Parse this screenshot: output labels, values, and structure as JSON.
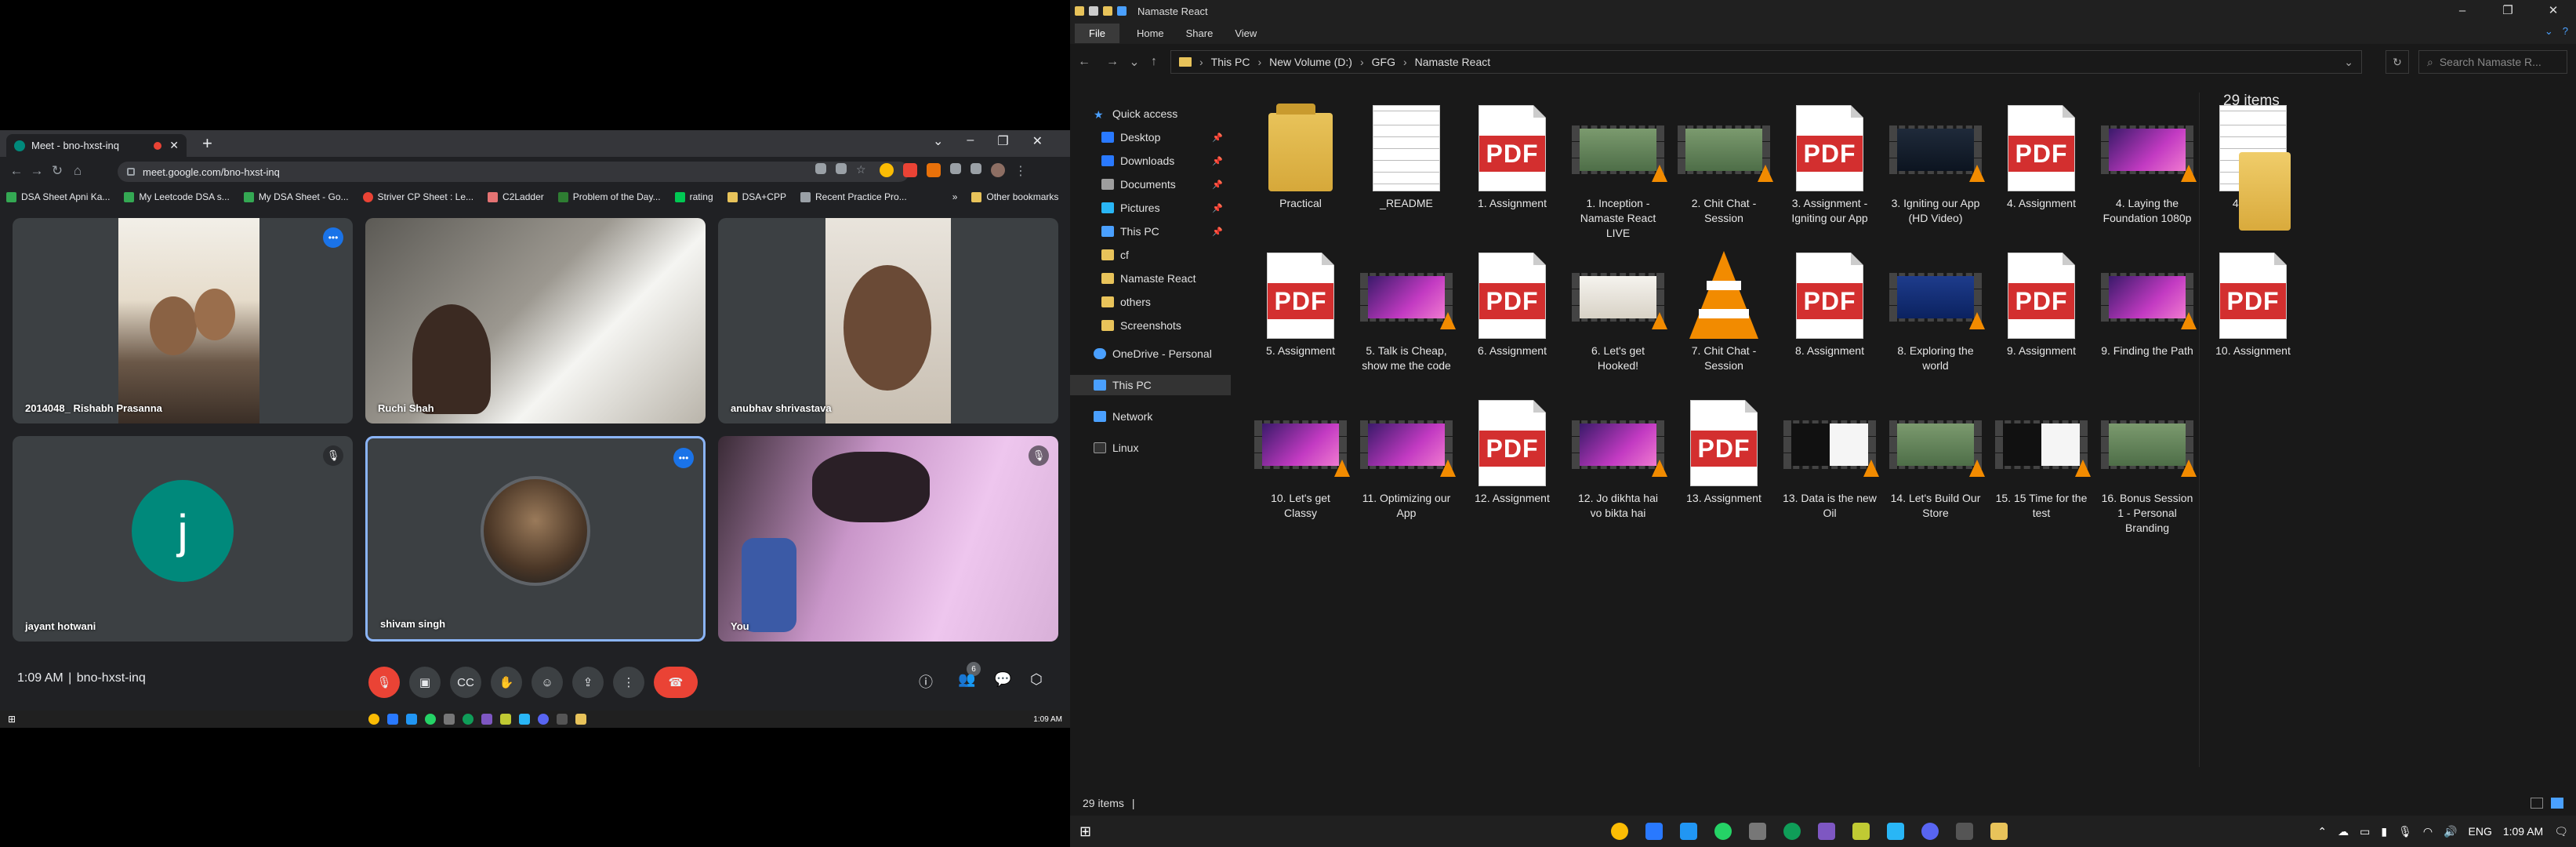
{
  "chrome": {
    "tab_title": "Meet - bno-hxst-inq",
    "url": "meet.google.com/bno-hxst-inq",
    "bookmarks": [
      "DSA Sheet Apni Ka...",
      "My Leetcode DSA s...",
      "My DSA Sheet - Go...",
      "Striver CP Sheet : Le...",
      "C2Ladder",
      "Problem of the Day...",
      "rating",
      "DSA+CPP",
      "Recent Practice Pro..."
    ],
    "other_bookmarks": "Other bookmarks"
  },
  "meet": {
    "participants": [
      {
        "name": "2014048_ Rishabh Prasanna"
      },
      {
        "name": "Ruchi Shah"
      },
      {
        "name": "anubhav shrivastava"
      },
      {
        "name": "jayant hotwani",
        "initial": "j"
      },
      {
        "name": "shivam singh"
      },
      {
        "name": "You"
      }
    ],
    "time": "1:09 AM",
    "separator": "|",
    "meeting_code": "bno-hxst-inq",
    "people_count": "6",
    "accent": "#1a73e8",
    "end_color": "#ea4335"
  },
  "left_taskbar": {
    "clock": "1:09 AM"
  },
  "explorer": {
    "window_title": "Namaste React",
    "ribbon_tabs": [
      "File",
      "Home",
      "Share",
      "View"
    ],
    "breadcrumb": [
      "This PC",
      "New Volume (D:)",
      "GFG",
      "Namaste React"
    ],
    "search_placeholder": "Search Namaste R...",
    "nav": {
      "quick_access": "Quick access",
      "items": [
        "Desktop",
        "Downloads",
        "Documents",
        "Pictures",
        "This PC",
        "cf",
        "Namaste React",
        "others",
        "Screenshots"
      ],
      "onedrive": "OneDrive - Personal",
      "this_pc": "This PC",
      "network": "Network",
      "linux": "Linux"
    },
    "files": [
      {
        "name": "Practical",
        "type": "folder"
      },
      {
        "name": "_README",
        "type": "text"
      },
      {
        "name": "1. Assignment",
        "type": "pdf"
      },
      {
        "name": "1. Inception - Namaste React LIVE",
        "type": "video-face"
      },
      {
        "name": "2. Chit Chat - Session",
        "type": "video-face"
      },
      {
        "name": "3. Assignment - Igniting our App",
        "type": "pdf"
      },
      {
        "name": "3. Igniting our App (HD Video)",
        "type": "video-dark"
      },
      {
        "name": "4. Assignment",
        "type": "pdf"
      },
      {
        "name": "4. Laying the Foundation 1080p",
        "type": "video-purple"
      },
      {
        "name": "4. Notes",
        "type": "text"
      },
      {
        "name": "5. Assignment",
        "type": "pdf"
      },
      {
        "name": "5. Talk is Cheap, show me the code",
        "type": "video-purple"
      },
      {
        "name": "6. Assignment",
        "type": "pdf"
      },
      {
        "name": "6. Let's get Hooked!",
        "type": "video-light"
      },
      {
        "name": "7. Chit Chat - Session",
        "type": "vlc"
      },
      {
        "name": "8. Assignment",
        "type": "pdf"
      },
      {
        "name": "8. Exploring the world",
        "type": "video-blue"
      },
      {
        "name": "9. Assignment",
        "type": "pdf"
      },
      {
        "name": "9. Finding the Path",
        "type": "video-purple"
      },
      {
        "name": "10. Assignment",
        "type": "pdf"
      },
      {
        "name": "10. Let's get Classy",
        "type": "video-purple"
      },
      {
        "name": "11. Optimizing our App",
        "type": "video-purple"
      },
      {
        "name": "12. Assignment",
        "type": "pdf"
      },
      {
        "name": "12. Jo dikhta hai vo bikta hai",
        "type": "video-purple"
      },
      {
        "name": "13. Assignment",
        "type": "pdf"
      },
      {
        "name": "13. Data is the new Oil",
        "type": "video-split"
      },
      {
        "name": "14. Let's Build Our Store",
        "type": "video-face"
      },
      {
        "name": "15. 15 Time for the test",
        "type": "video-split"
      },
      {
        "name": "16. Bonus Session 1 - Personal Branding",
        "type": "video-face"
      }
    ],
    "pdf_label": "PDF",
    "item_count": "29 items",
    "status_count": "29 items",
    "status_sep": "|"
  },
  "right_taskbar": {
    "lang": "ENG",
    "clock": "1:09 AM"
  }
}
